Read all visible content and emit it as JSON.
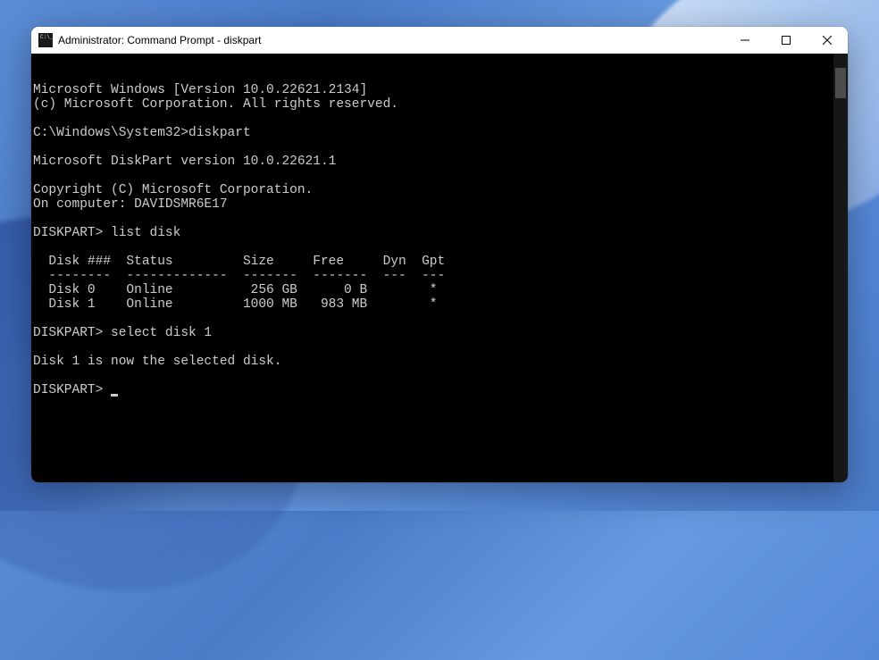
{
  "window": {
    "title": "Administrator: Command Prompt - diskpart"
  },
  "terminal": {
    "lines": [
      "Microsoft Windows [Version 10.0.22621.2134]",
      "(c) Microsoft Corporation. All rights reserved.",
      "",
      "C:\\Windows\\System32>diskpart",
      "",
      "Microsoft DiskPart version 10.0.22621.1",
      "",
      "Copyright (C) Microsoft Corporation.",
      "On computer: DAVIDSMR6E17",
      "",
      "DISKPART> list disk",
      "",
      "  Disk ###  Status         Size     Free     Dyn  Gpt",
      "  --------  -------------  -------  -------  ---  ---",
      "  Disk 0    Online          256 GB      0 B        *",
      "  Disk 1    Online         1000 MB   983 MB        *",
      "",
      "DISKPART> select disk 1",
      "",
      "Disk 1 is now the selected disk.",
      "",
      "DISKPART> "
    ]
  },
  "chart_data": {
    "type": "table",
    "title": "DISKPART list disk",
    "columns": [
      "Disk ###",
      "Status",
      "Size",
      "Free",
      "Dyn",
      "Gpt"
    ],
    "rows": [
      [
        "Disk 0",
        "Online",
        "256 GB",
        "0 B",
        "",
        "*"
      ],
      [
        "Disk 1",
        "Online",
        "1000 MB",
        "983 MB",
        "",
        "*"
      ]
    ]
  }
}
